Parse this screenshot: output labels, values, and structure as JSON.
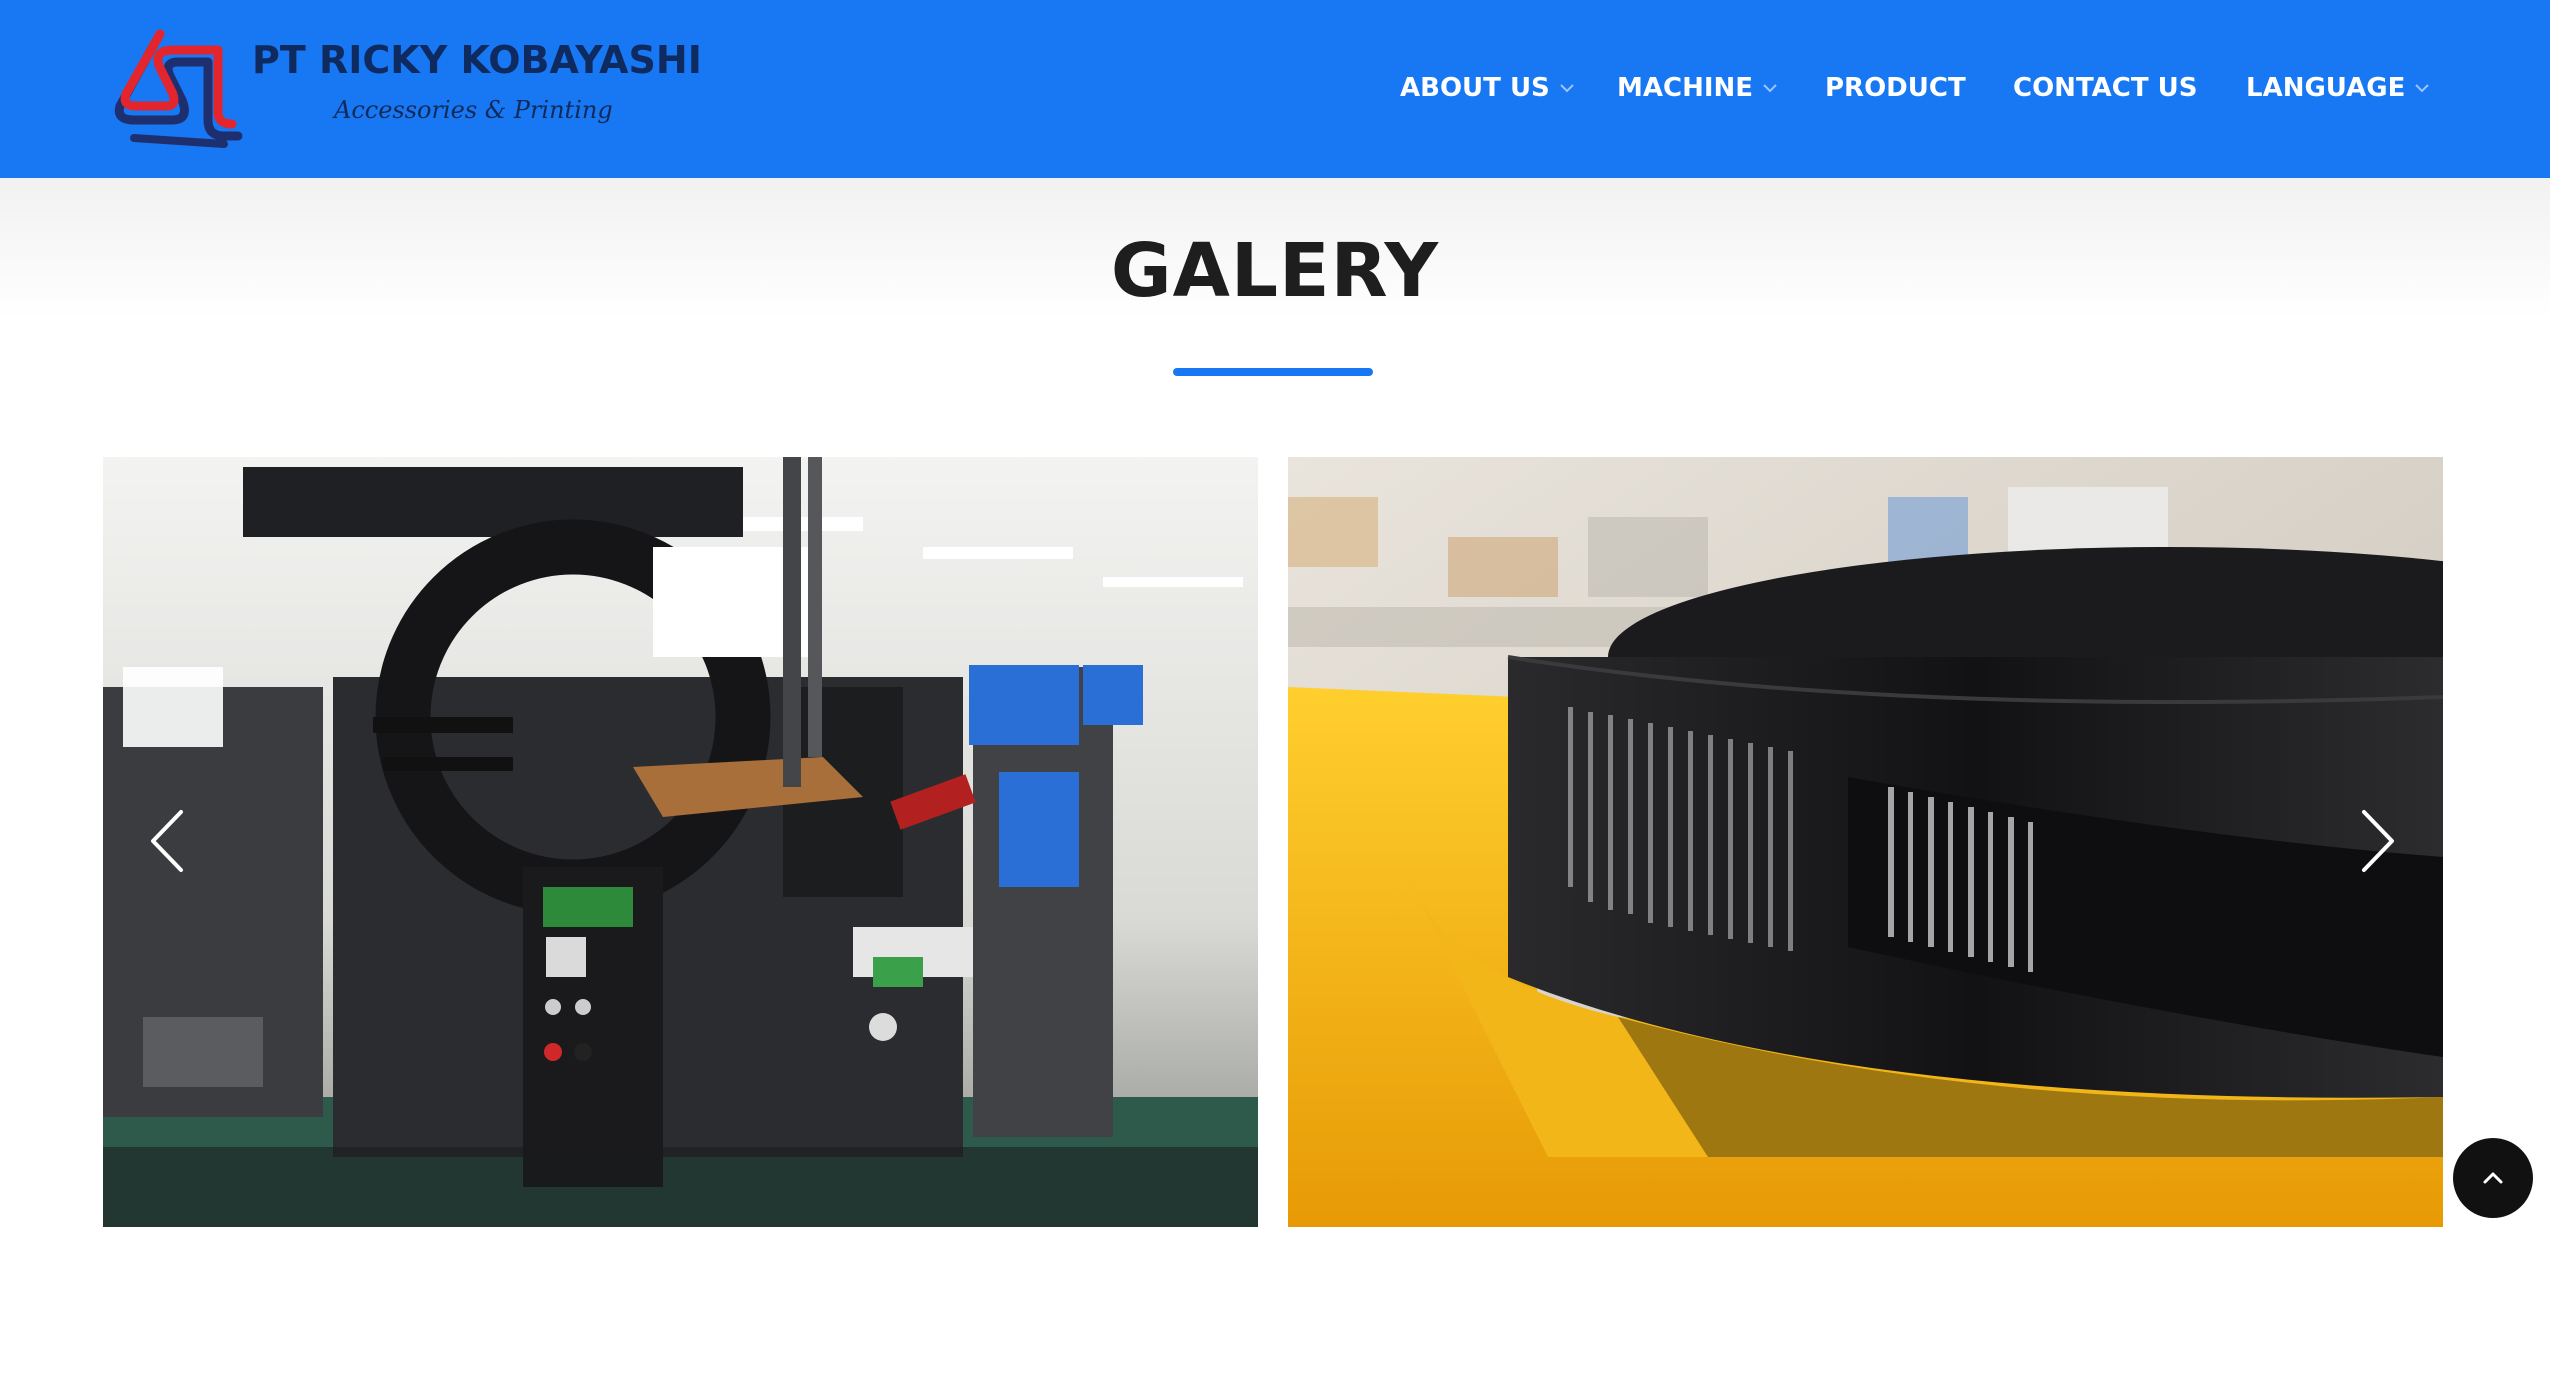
{
  "brand": {
    "name": "PT RICKY KOBAYASHI",
    "tagline": "Accessories & Printing",
    "logo_icon": "ricky-kobayashi-logo-icon"
  },
  "nav": {
    "items": [
      {
        "label": "ABOUT US",
        "has_dropdown": true
      },
      {
        "label": "MACHINE",
        "has_dropdown": true
      },
      {
        "label": "PRODUCT",
        "has_dropdown": false
      },
      {
        "label": "CONTACT US",
        "has_dropdown": false
      },
      {
        "label": "LANGUAGE",
        "has_dropdown": true
      }
    ]
  },
  "gallery": {
    "title": "GALERY",
    "slides": [
      {
        "alt": "printing-machine-photo"
      },
      {
        "alt": "label-ribbon-roll-photo"
      }
    ],
    "prev_icon": "chevron-left-icon",
    "next_icon": "chevron-right-icon"
  },
  "scroll_top": {
    "icon": "chevron-up-icon"
  },
  "colors": {
    "header_bg": "#1877f2",
    "accent": "#1877f2",
    "title": "#1e1e1e",
    "logo_red": "#e3262e",
    "logo_navy": "#1d2f6f"
  }
}
